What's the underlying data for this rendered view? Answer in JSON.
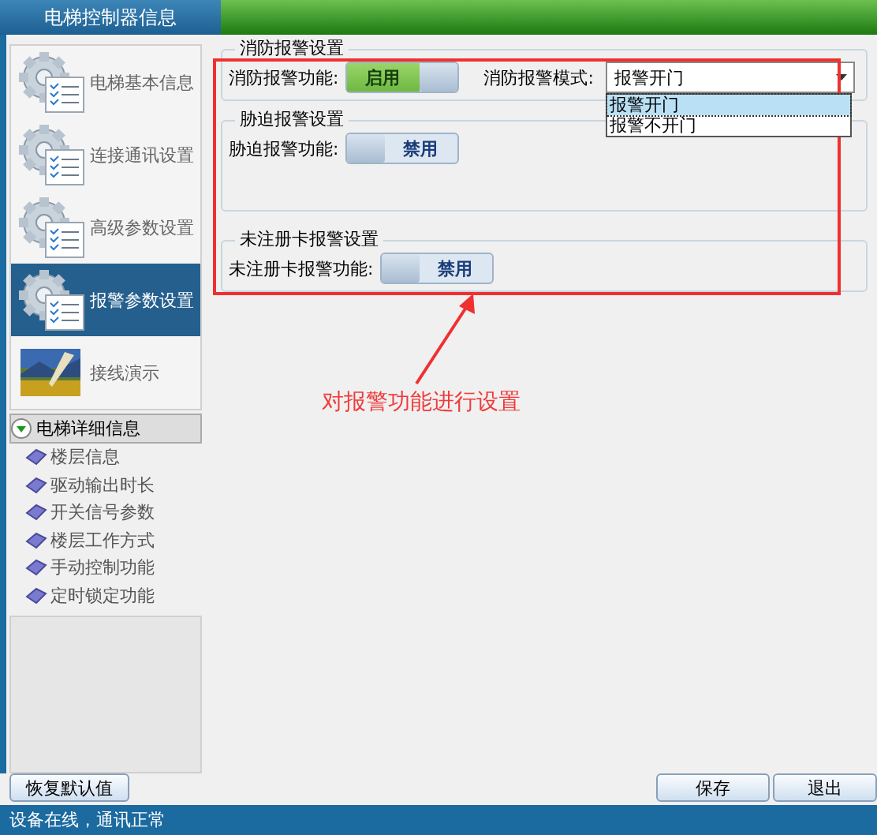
{
  "header": {
    "title": "电梯控制器信息"
  },
  "sidebar": {
    "items": [
      {
        "label": "电梯基本信息",
        "kind": "gear",
        "selected": false
      },
      {
        "label": "连接通讯设置",
        "kind": "gear",
        "selected": false
      },
      {
        "label": "高级参数设置",
        "kind": "gear",
        "selected": false
      },
      {
        "label": "报警参数设置",
        "kind": "gear",
        "selected": true
      },
      {
        "label": "接线演示",
        "kind": "picture",
        "selected": false
      }
    ],
    "detail_group": {
      "label": "电梯详细信息",
      "expanded": true,
      "items": [
        "楼层信息",
        "驱动输出时长",
        "开关信号参数",
        "楼层工作方式",
        "手动控制功能",
        "定时锁定功能"
      ]
    }
  },
  "groups": [
    {
      "legend": "消防报警设置",
      "label": "消防报警功能:",
      "toggle": {
        "label": "启用",
        "on": true
      },
      "mode": {
        "label": "消防报警模式:",
        "value": "报警开门",
        "options": [
          {
            "label": "报警开门",
            "selected": true
          },
          {
            "label": "报警不开门",
            "selected": false
          }
        ]
      }
    },
    {
      "legend": "胁迫报警设置",
      "label": "胁迫报警功能:",
      "toggle": {
        "label": "禁用",
        "on": false
      }
    },
    {
      "legend": "未注册卡报警设置",
      "label": "未注册卡报警功能:",
      "toggle": {
        "label": "禁用",
        "on": false
      }
    }
  ],
  "annotation": {
    "text": "对报警功能进行设置"
  },
  "buttons": {
    "reset": "恢复默认值",
    "save": "保存",
    "exit": "退出"
  },
  "status_bar": {
    "text": "设备在线，通讯正常"
  }
}
